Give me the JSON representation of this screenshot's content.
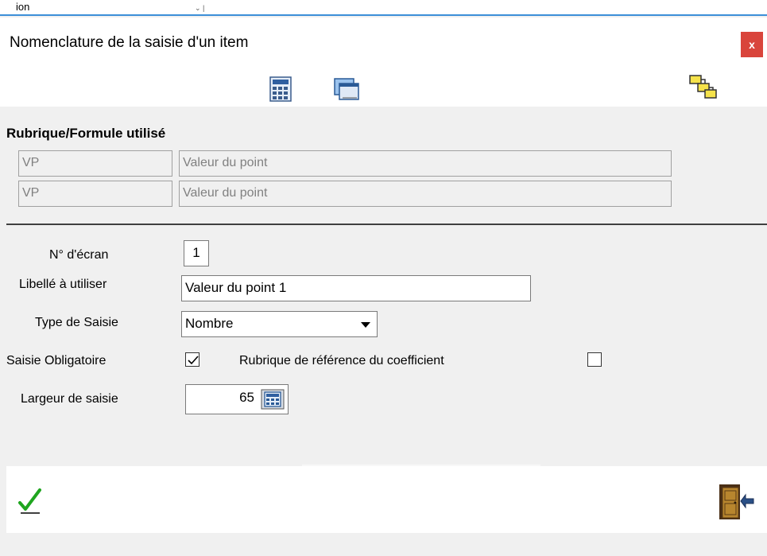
{
  "background_window": {
    "label_fragment": "ion",
    "arrow": "⌄ |"
  },
  "dialog": {
    "title": "Nomenclature de la saisie d'un item",
    "close_label": "x"
  },
  "toolbar": {
    "icons": [
      "calculator-icon",
      "monitor-window-icon",
      "hierarchy-icon"
    ]
  },
  "rubrique": {
    "section_title": "Rubrique/Formule utilisé",
    "rows": [
      {
        "code": "VP",
        "label": "Valeur du point"
      },
      {
        "code": "VP",
        "label": "Valeur du point"
      }
    ]
  },
  "form": {
    "screen_no_label": "N° d'écran",
    "screen_no_value": "1",
    "libelle_label": "Libellé à utiliser",
    "libelle_value": "Valeur du point 1",
    "type_label": "Type de Saisie",
    "type_value": "Nombre",
    "obligatoire_label": "Saisie Obligatoire",
    "obligatoire_checked": true,
    "rubrique_ref_label": "Rubrique de référence du coefficient",
    "rubrique_ref_checked": false,
    "largeur_label": "Largeur de saisie",
    "largeur_value": "65"
  },
  "footer": {
    "validate_icon": "green-checkmark-icon",
    "exit_icon": "exit-door-icon"
  },
  "colors": {
    "accent_blue": "#3c8fd8",
    "close_red": "#d9443b",
    "check_green": "#1fa51f"
  }
}
